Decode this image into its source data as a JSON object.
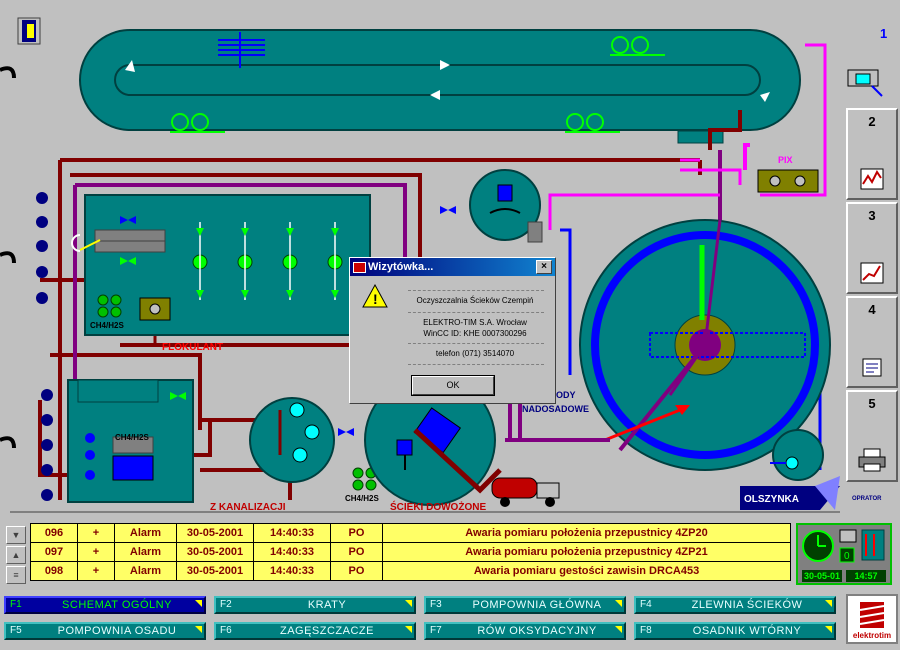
{
  "screen_number": "1",
  "labels": {
    "pix": "PIX",
    "flokulant": "FLOKULANT",
    "ch4_1": "CH4/H2S",
    "ch4_2": "CH4/H2S",
    "ch4_3": "CH4/H2S",
    "z_kanalizacji": "Z KANALIZACJI",
    "scieki_dowozone": "ŚCIEKI DOWOŻONE",
    "wody": "ODY",
    "nadosadowe": "NADOSADOWE",
    "olszynka": "OLSZYNKA",
    "oprator": "OPRATOR"
  },
  "right_panel": {
    "buttons": [
      {
        "num": "2",
        "icon": "trend-chart-icon"
      },
      {
        "num": "3",
        "icon": "line-graph-icon"
      },
      {
        "num": "4",
        "icon": "report-icon"
      },
      {
        "num": "5",
        "icon": "printer-icon"
      }
    ]
  },
  "dialog": {
    "title": "Wizytówka...",
    "close": "×",
    "line1": "Oczyszczalnia Ścieków Czempiń",
    "line2": "ELEKTRO-TIM S.A. Wrocław",
    "line3": "WinCC ID: KHE  0007300296",
    "line4": "telefon (071) 3514070",
    "ok": "OK"
  },
  "alarms": [
    {
      "id": "096",
      "sign": "+",
      "type": "Alarm",
      "date": "30-05-2001",
      "time": "14:40:33",
      "code": "PO",
      "msg": "Awaria pomiaru położenia przepustnicy 4ZP20"
    },
    {
      "id": "097",
      "sign": "+",
      "type": "Alarm",
      "date": "30-05-2001",
      "time": "14:40:33",
      "code": "PO",
      "msg": "Awaria pomiaru położenia przepustnicy 4ZP21"
    },
    {
      "id": "098",
      "sign": "+",
      "type": "Alarm",
      "date": "30-05-2001",
      "time": "14:40:33",
      "code": "PO",
      "msg": "Awaria pomiaru gestości zawisin DRCA453"
    }
  ],
  "status": {
    "date": "30-05-01",
    "time": "14:57",
    "indicator": "0"
  },
  "fkeys": [
    {
      "key": "F1",
      "label": "SCHEMAT OGÓLNY"
    },
    {
      "key": "F2",
      "label": "KRATY"
    },
    {
      "key": "F3",
      "label": "POMPOWNIA GŁÓWNA"
    },
    {
      "key": "F4",
      "label": "ZLEWNIA ŚCIEKÓW"
    },
    {
      "key": "F5",
      "label": "POMPOWNIA OSADU"
    },
    {
      "key": "F6",
      "label": "ZAGĘSZCZACZE"
    },
    {
      "key": "F7",
      "label": "RÓW OKSYDACYJNY"
    },
    {
      "key": "F8",
      "label": "OSADNIK WTÓRNY"
    }
  ],
  "logo_text": "elektrotim",
  "colors": {
    "tank": "#008080",
    "pipe_red": "#800000",
    "pipe_purple": "#800080",
    "pipe_magenta": "#ff00ff",
    "pipe_blue": "#0000ff",
    "alarm_bg": "#ffff66"
  }
}
